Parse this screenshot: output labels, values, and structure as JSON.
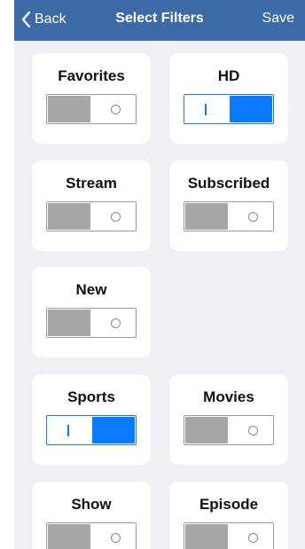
{
  "navbar": {
    "back_label": "Back",
    "title": "Select Filters",
    "save_label": "Save"
  },
  "filters": [
    {
      "label": "Favorites",
      "state": "off"
    },
    {
      "label": "HD",
      "state": "on"
    },
    {
      "label": "Stream",
      "state": "off"
    },
    {
      "label": "Subscribed",
      "state": "off"
    },
    {
      "label": "New",
      "state": "off"
    },
    {
      "label": "Sports",
      "state": "on"
    },
    {
      "label": "Movies",
      "state": "off"
    },
    {
      "label": "Show",
      "state": "off"
    },
    {
      "label": "Episode",
      "state": "off"
    }
  ],
  "colors": {
    "navbar": "#3b6aa6",
    "toggle_on": "#0a7aff",
    "toggle_off": "#a6a6a6",
    "background": "#efeff4"
  }
}
